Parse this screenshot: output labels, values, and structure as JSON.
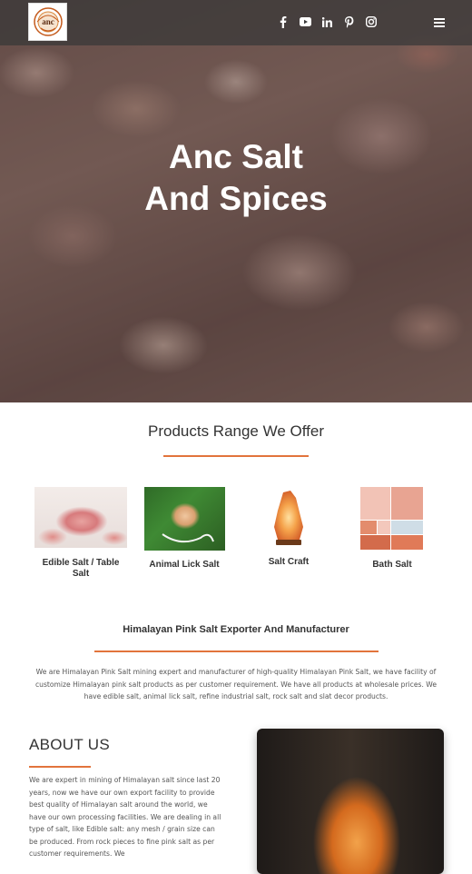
{
  "header": {
    "logo_text": "anc",
    "social_icons": [
      "facebook-icon",
      "youtube-icon",
      "linkedin-icon",
      "pinterest-icon",
      "instagram-icon"
    ],
    "menu_icon": "hamburger-menu-icon"
  },
  "hero": {
    "title_line1": "Anc Salt",
    "title_line2": "And Spices"
  },
  "products": {
    "heading": "Products Range We Offer",
    "items": [
      {
        "label_line1": "Edible Salt / Table",
        "label_line2": "Salt"
      },
      {
        "label_line1": "Animal Lick Salt",
        "label_line2": ""
      },
      {
        "label_line1": "Salt Craft",
        "label_line2": ""
      },
      {
        "label_line1": "Bath Salt",
        "label_line2": ""
      }
    ]
  },
  "exporter": {
    "heading": "Himalayan Pink Salt Exporter And Manufacturer",
    "text": "We are Himalayan Pink Salt mining expert and manufacturer of high-quality Himalayan Pink Salt, we have facility of customize Himalayan pink salt products as per customer requirement. We have all products at wholesale prices. We have edible salt, animal lick salt, refine industrial salt, rock salt and slat decor products."
  },
  "about": {
    "heading": "ABOUT US",
    "text": "We are expert in mining of Himalayan salt since last 20 years, now we have our own export facility to provide best quality of Himalayan salt around the world, we have our own processing facilities. We are dealing in all type of salt, like Edible salt: any mesh / grain size can be produced. From rock pieces to fine pink salt as per customer requirements. We"
  },
  "colors": {
    "accent": "#e2743c",
    "header_bg": "#373737"
  }
}
